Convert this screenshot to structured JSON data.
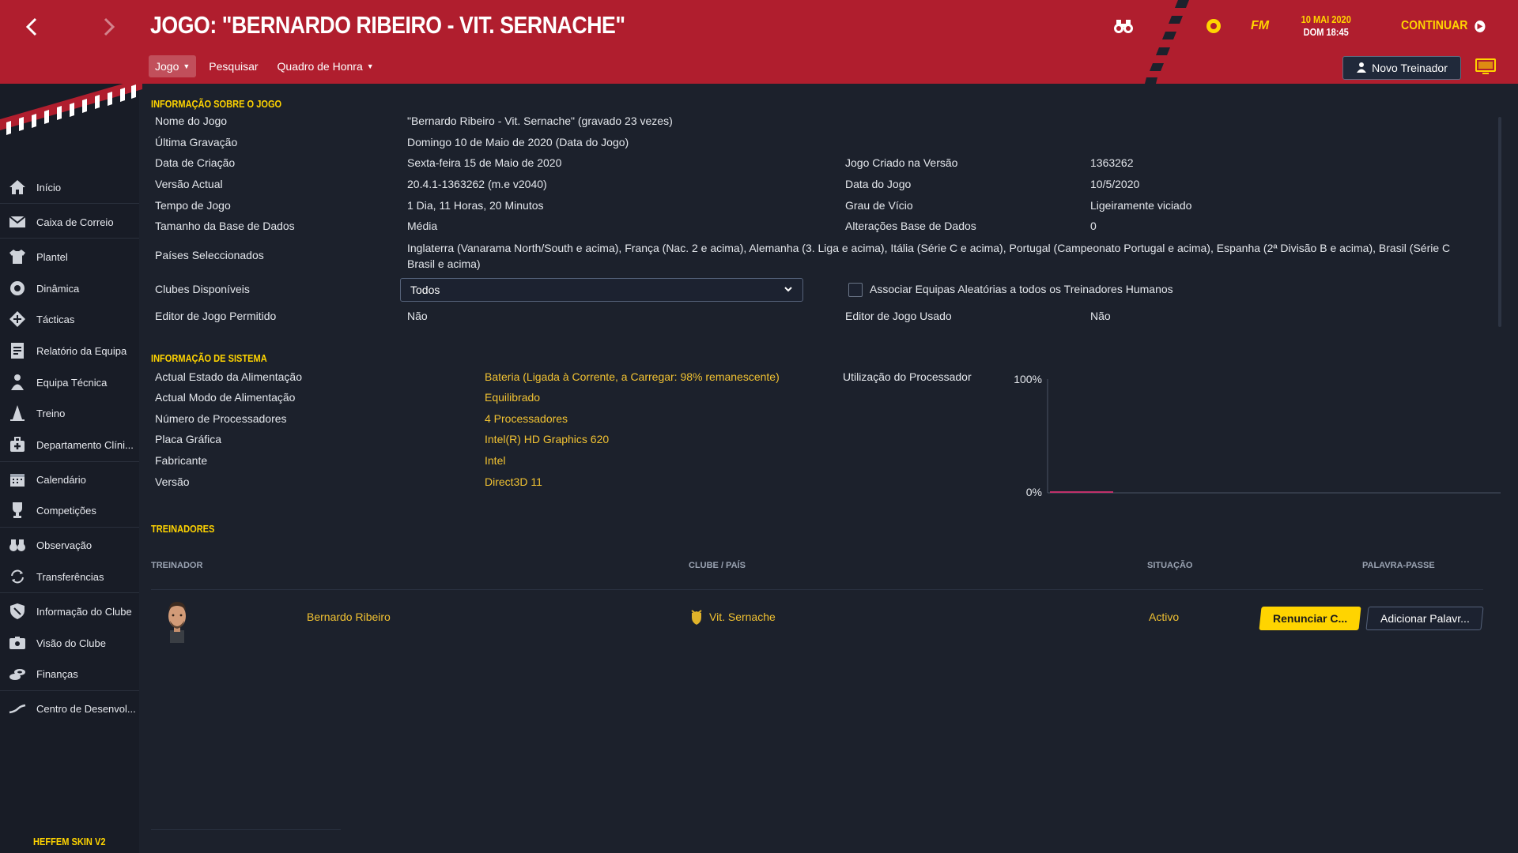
{
  "header": {
    "title": "JOGO: \"BERNARDO RIBEIRO - VIT. SERNACHE\"",
    "tabs": [
      {
        "label": "Jogo"
      },
      {
        "label": "Pesquisar"
      },
      {
        "label": "Quadro de Honra"
      }
    ],
    "date_line1": "10 MAI 2020",
    "date_line2": "DOM 18:45",
    "fm_logo": "FM",
    "continue_label": "CONTINUAR",
    "new_coach_label": "Novo Treinador"
  },
  "sidebar": {
    "items": [
      {
        "label": "Início",
        "icon": "home-icon"
      },
      {
        "label": "Caixa de Correio",
        "icon": "mail-icon"
      },
      {
        "label": "Plantel",
        "icon": "shirt-icon"
      },
      {
        "label": "Dinâmica",
        "icon": "dynamics-icon"
      },
      {
        "label": "Tácticas",
        "icon": "tactics-icon"
      },
      {
        "label": "Relatório da Equipa",
        "icon": "report-icon"
      },
      {
        "label": "Equipa Técnica",
        "icon": "staff-icon"
      },
      {
        "label": "Treino",
        "icon": "cone-icon"
      },
      {
        "label": "Departamento Clíni...",
        "icon": "medical-icon"
      },
      {
        "label": "Calendário",
        "icon": "calendar-icon"
      },
      {
        "label": "Competições",
        "icon": "trophy-icon"
      },
      {
        "label": "Observação",
        "icon": "binoculars-icon"
      },
      {
        "label": "Transferências",
        "icon": "transfer-icon"
      },
      {
        "label": "Informação do Clube",
        "icon": "shield-icon"
      },
      {
        "label": "Visão do Clube",
        "icon": "vision-icon"
      },
      {
        "label": "Finanças",
        "icon": "finance-icon"
      },
      {
        "label": "Centro de Desenvol...",
        "icon": "development-icon"
      }
    ],
    "skin_label": "HEFFEM SKIN V2"
  },
  "game_info": {
    "section_title": "INFORMAÇÃO SOBRE O JOGO",
    "rows": [
      {
        "label": "Nome do Jogo",
        "value": "\"Bernardo Ribeiro - Vit. Sernache\" (gravado 23 vezes)"
      },
      {
        "label": "Última Gravação",
        "value": "Domingo 10 de Maio de 2020 (Data do Jogo)"
      },
      {
        "label": "Data de Criação",
        "value": "Sexta-feira 15 de Maio de 2020"
      },
      {
        "label": "Versão Actual",
        "value": "20.4.1-1363262 (m.e v2040)"
      },
      {
        "label": "Tempo de Jogo",
        "value": "1 Dia, 11 Horas, 20 Minutos"
      },
      {
        "label": "Tamanho da Base de Dados",
        "value": "Média"
      },
      {
        "label": "Países Seleccionados",
        "value": "Inglaterra (Vanarama North/South e acima), França (Nac. 2 e acima), Alemanha (3. Liga e acima), Itália (Série C e acima), Portugal (Campeonato Portugal e acima), Espanha (2ª Divisão B e acima), Brasil (Série C Brasil e acima)"
      },
      {
        "label": "Clubes Disponíveis",
        "value": "Todos"
      },
      {
        "label": "Editor de Jogo Permitido",
        "value": "Não"
      }
    ],
    "right_rows": [
      {
        "label": "Jogo Criado na Versão",
        "value": "1363262"
      },
      {
        "label": "Data do Jogo",
        "value": "10/5/2020"
      },
      {
        "label": "Grau de Vício",
        "value": "Ligeiramente viciado"
      },
      {
        "label": "Alterações Base de Dados",
        "value": "0"
      },
      {
        "label": "Editor de Jogo Usado",
        "value": "Não"
      }
    ],
    "checkbox_label": "Associar Equipas Aleatórias a todos os Treinadores Humanos"
  },
  "system_info": {
    "section_title": "INFORMAÇÃO DE SISTEMA",
    "rows": [
      {
        "label": "Actual Estado da Alimentação",
        "value": "Bateria (Ligada à Corrente, a Carregar: 98% remanescente)"
      },
      {
        "label": "Actual Modo de Alimentação",
        "value": "Equilibrado"
      },
      {
        "label": "Número de Processadores",
        "value": "4 Processadores"
      },
      {
        "label": "Placa Gráfica",
        "value": "Intel(R) HD Graphics 620"
      },
      {
        "label": "Fabricante",
        "value": "Intel"
      },
      {
        "label": "Versão",
        "value": "Direct3D 11"
      }
    ],
    "cpu_label": "Utilização do Processador"
  },
  "chart_data": {
    "type": "line",
    "title": "Utilização do Processador",
    "ylim": [
      0,
      100
    ],
    "y_tick_labels": [
      "100%",
      "0%"
    ],
    "series": [
      {
        "values": [
          0,
          0,
          0,
          0,
          0,
          0
        ]
      }
    ],
    "line_color": "#c0306a"
  },
  "coaches": {
    "section_title": "TREINADORES",
    "columns": [
      "TREINADOR",
      "CLUBE / PAÍS",
      "SITUAÇÃO",
      "PALAVRA-PASSE"
    ],
    "rows": [
      {
        "name": "Bernardo Ribeiro",
        "club": "Vit. Sernache",
        "status": "Activo",
        "resign_label": "Renunciar C...",
        "password_label": "Adicionar Palavr..."
      }
    ]
  },
  "colors": {
    "header_red": "#b01e2e",
    "accent_gold": "#ffd400",
    "background": "#1c212c"
  }
}
